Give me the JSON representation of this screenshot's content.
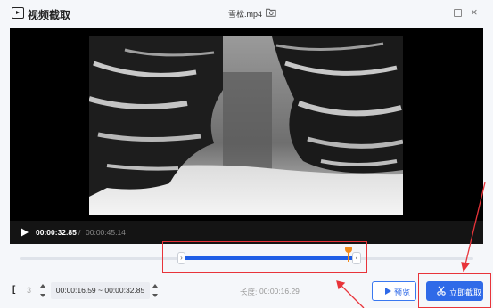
{
  "window": {
    "app_title": "视频截取",
    "file_name": "雪松.mp4",
    "icons": {
      "app": "video-clip-icon",
      "folder": "folder-icon",
      "maximize": "maximize-icon",
      "close": "close-icon"
    }
  },
  "player": {
    "current_time": "00:00:32.85",
    "separator": "/",
    "total_time": "00:00:45.14",
    "play_icon": "play-icon"
  },
  "timeline": {
    "selection_start_fraction": 0.364,
    "selection_end_fraction": 0.728,
    "playhead_fraction": 0.728,
    "handle_left_glyph": "›",
    "handle_right_glyph": "‹"
  },
  "bottom": {
    "bracket_glyph": "[",
    "step_value": "3",
    "range_text": "00:00:16.59 ~ 00:00:32.85",
    "length_label": "长度:",
    "length_value": "00:00:16.29",
    "preview_label": "预览",
    "capture_label": "立即截取"
  },
  "colors": {
    "accent": "#2f6ae8",
    "playhead": "#f28b1c",
    "annotation": "#e8343a"
  }
}
